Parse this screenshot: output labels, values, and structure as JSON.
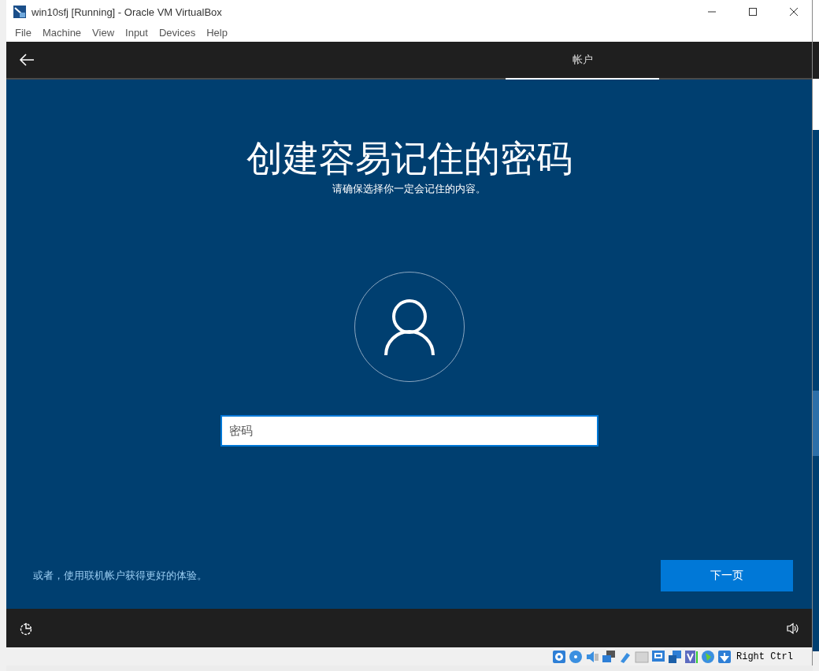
{
  "window": {
    "title": "win10sfj [Running] - Oracle VM VirtualBox"
  },
  "menu": [
    "File",
    "Machine",
    "View",
    "Input",
    "Devices",
    "Help"
  ],
  "tabs": [
    {
      "label": "帐户",
      "selected": true
    }
  ],
  "heading": "创建容易记住的密码",
  "subheading": "请确保选择你一定会记住的内容。",
  "password_field": {
    "placeholder": "密码"
  },
  "online_account_link": "或者，使用联机帐户获得更好的体验。",
  "next_button": "下一页",
  "status_bar": {
    "host_key": "Right Ctrl"
  }
}
